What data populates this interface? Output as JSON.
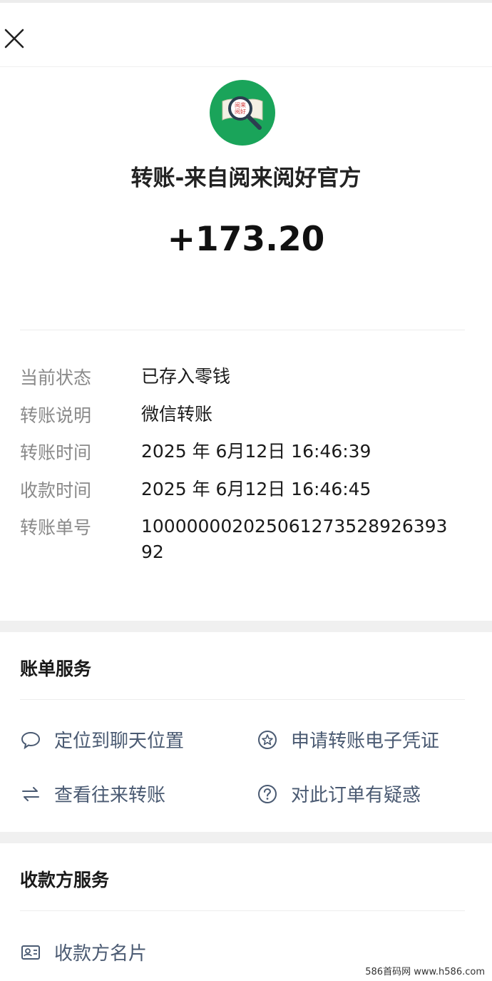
{
  "header": {
    "close_icon": "close-icon"
  },
  "payer": {
    "name": "转账-来自阅来阅好官方",
    "logo_text": "阅来阅好",
    "logo_icon": "book-magnifier-logo"
  },
  "transfer": {
    "amount": "+173.20"
  },
  "details": [
    {
      "label": "当前状态",
      "value": "已存入零钱"
    },
    {
      "label": "转账说明",
      "value": "微信转账"
    },
    {
      "label": "转账时间",
      "value": "2025 年 6月12日 16:46:39"
    },
    {
      "label": "收款时间",
      "value": "2025 年 6月12日 16:46:45"
    },
    {
      "label": "转账单号",
      "value": "100000002025061273528926393 92"
    }
  ],
  "bill_services": {
    "title": "账单服务",
    "items": [
      {
        "label": "定位到聊天位置",
        "icon": "chat-bubble-icon"
      },
      {
        "label": "申请转账电子凭证",
        "icon": "star-badge-icon"
      },
      {
        "label": "查看往来转账",
        "icon": "exchange-arrows-icon"
      },
      {
        "label": "对此订单有疑惑",
        "icon": "question-icon"
      }
    ]
  },
  "payee_services": {
    "title": "收款方服务",
    "items": [
      {
        "label": "收款方名片",
        "icon": "contact-card-icon"
      }
    ]
  },
  "watermark": "586首码网 www.h586.com",
  "colors": {
    "logo_green": "#1aa45a",
    "link_blue_gray": "#4a5a72",
    "label_gray": "#8a8a8a"
  }
}
